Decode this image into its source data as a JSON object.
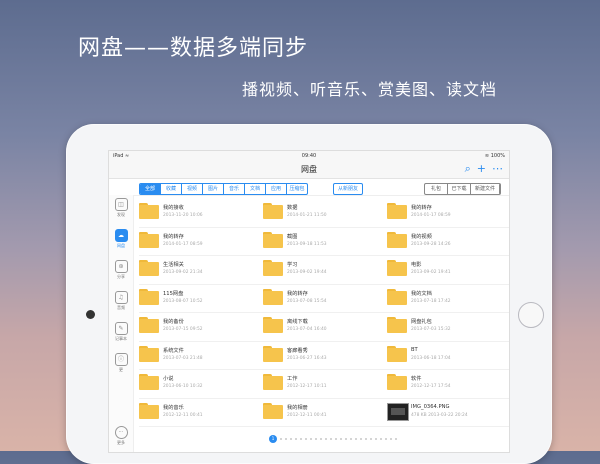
{
  "promo": {
    "headline": "网盘——数据多端同步",
    "subline": "播视频、听音乐、赏美图、读文档"
  },
  "statusbar": {
    "left": "iPad ≈",
    "time": "09:40",
    "right": "≋ 100%"
  },
  "navbar": {
    "title": "网盘",
    "icons": [
      "search-icon",
      "add-icon",
      "more-icon"
    ]
  },
  "filter_tabs": [
    "全部",
    "收藏",
    "视频",
    "图片",
    "音乐",
    "文档",
    "应用",
    "压缩包"
  ],
  "from_friend": "从新朋友",
  "right_tabs": [
    "礼包",
    "已下载",
    "新建文件"
  ],
  "sidebar": [
    {
      "label": "发现",
      "icon": "discover-icon"
    },
    {
      "label": "网盘",
      "icon": "netdisk-icon",
      "active": true
    },
    {
      "label": "分享",
      "icon": "share-icon"
    },
    {
      "label": "音频",
      "icon": "headphone-icon"
    },
    {
      "label": "记事本",
      "icon": "notepad-icon"
    },
    {
      "label": "更",
      "icon": "info-icon"
    }
  ],
  "sidebar_bottom": {
    "label": "更多"
  },
  "files": [
    {
      "name": "我的接收",
      "meta": "2013-11-20 10:06"
    },
    {
      "name": "数据",
      "meta": "2014-01-21 11:50"
    },
    {
      "name": "我的转存",
      "meta": "2014-01-17 08:59"
    },
    {
      "name": "我的转存",
      "meta": "2014-01-17 08:59"
    },
    {
      "name": "截图",
      "meta": "2013-09-18 11:53"
    },
    {
      "name": "我的视频",
      "meta": "2013-09-28 14:26"
    },
    {
      "name": "生活相关",
      "meta": "2013-09-02 21:34"
    },
    {
      "name": "学习",
      "meta": "2013-09-02 19:44"
    },
    {
      "name": "电影",
      "meta": "2013-09-02 19:41"
    },
    {
      "name": "115网盘",
      "meta": "2013-08-07 10:52"
    },
    {
      "name": "我的转存",
      "meta": "2013-07-08 15:54"
    },
    {
      "name": "我的文档",
      "meta": "2013-07-18 17:42"
    },
    {
      "name": "我的备份",
      "meta": "2013-07-15 09:52"
    },
    {
      "name": "离线下载",
      "meta": "2013-07-04 16:40"
    },
    {
      "name": "网盘礼包",
      "meta": "2013-07-03 15:32"
    },
    {
      "name": "系统文件",
      "meta": "2013-07-03 21:48"
    },
    {
      "name": "客廊看秀",
      "meta": "2013-06-27 16:43"
    },
    {
      "name": "BT",
      "meta": "2013-06-18 17:04"
    },
    {
      "name": "小说",
      "meta": "2013-06-10 10:32"
    },
    {
      "name": "工作",
      "meta": "2012-12-17 10:11"
    },
    {
      "name": "软件",
      "meta": "2012-12-17 17:54"
    },
    {
      "name": "我的音乐",
      "meta": "2012-12-11 00:41"
    },
    {
      "name": "我的相册",
      "meta": "2012-12-11 00:41"
    },
    {
      "name": "IMG_0364.PNG",
      "meta": "478 KB 2013-03-22 20:24",
      "type": "image"
    }
  ],
  "pager": {
    "current": "1",
    "dots": 24
  }
}
